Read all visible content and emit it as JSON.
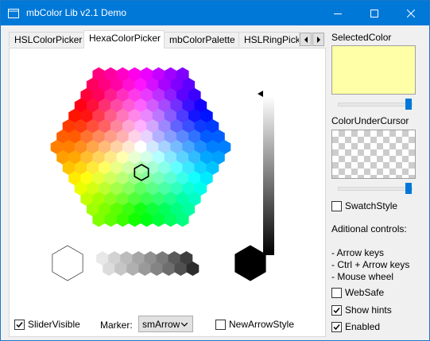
{
  "window": {
    "title": "mbColor Lib v2.1 Demo"
  },
  "tabs": [
    {
      "label": "HSLColorPicker"
    },
    {
      "label": "HexaColorPicker"
    },
    {
      "label": "mbColorPalette"
    },
    {
      "label": "HSLRingPicker"
    }
  ],
  "active_tab": "HexaColorPicker",
  "hexa": {
    "slider_visible_label": "SliderVisible",
    "slider_visible_checked": true,
    "marker_label": "Marker:",
    "marker_value": "smArrow",
    "new_arrow_style_label": "NewArrowStyle",
    "new_arrow_style_checked": false
  },
  "side": {
    "selected_color_label": "SelectedColor",
    "selected_color": "#ffffa8",
    "color_under_cursor_label": "ColorUnderCursor",
    "swatch_style_label": "SwatchStyle",
    "swatch_style_checked": false,
    "additional_title": "Aditional controls:",
    "additional_lines": [
      "- Arrow keys",
      "- Ctrl + Arrow keys",
      "- Mouse wheel"
    ],
    "websafe_label": "WebSafe",
    "websafe_checked": false,
    "show_hints_label": "Show hints",
    "show_hints_checked": true,
    "enabled_label": "Enabled",
    "enabled_checked": true
  },
  "colors": {
    "accent": "#0078d7",
    "titlebar_text": "#ffffff"
  }
}
